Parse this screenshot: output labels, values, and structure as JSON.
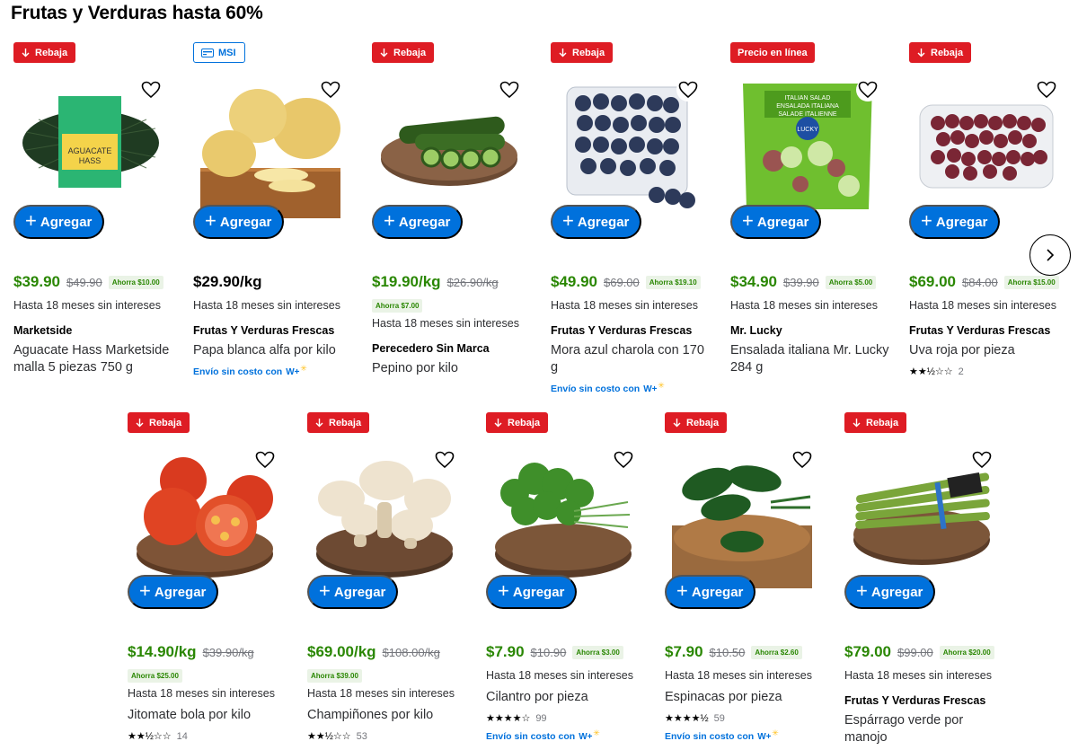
{
  "page": {
    "title": "Frutas y Verduras hasta 60%"
  },
  "controls": {
    "add_label": "Agregar",
    "next_icon": "chevron-right-icon"
  },
  "products": [
    {
      "badge": "Rebaja",
      "badge_type": "rebaja",
      "price": "$39.90",
      "old_price": "$49.90",
      "savings": "Ahorra $10.00",
      "savings_inline": true,
      "msi": "Hasta 18 meses sin intereses",
      "brand": "Marketside",
      "name": "Aguacate Hass Marketside malla 5 piezas 750 g",
      "image": "avocado-bag"
    },
    {
      "badge": "MSI",
      "badge_type": "msi",
      "price": "$29.90/kg",
      "price_black": true,
      "msi": "Hasta 18 meses sin intereses",
      "brand": "Frutas Y Verduras Frescas",
      "name": "Papa blanca alfa por kilo",
      "shipping": "Envío sin costo con",
      "shipping_logo": "W+",
      "image": "potatoes"
    },
    {
      "badge": "Rebaja",
      "badge_type": "rebaja",
      "price": "$19.90/kg",
      "old_price": "$26.90/kg",
      "savings": "Ahorra $7.00",
      "savings_inline": false,
      "msi": "Hasta 18 meses sin intereses",
      "brand": "Perecedero Sin Marca",
      "name": "Pepino por kilo",
      "image": "cucumber"
    },
    {
      "badge": "Rebaja",
      "badge_type": "rebaja",
      "price": "$49.90",
      "old_price": "$69.00",
      "savings": "Ahorra $19.10",
      "savings_inline": true,
      "msi": "Hasta 18 meses sin intereses",
      "brand": "Frutas Y Verduras Frescas",
      "name": "Mora azul charola con 170 g",
      "shipping": "Envío sin costo con",
      "shipping_logo": "W+",
      "image": "blueberries"
    },
    {
      "badge": "Precio en línea",
      "badge_type": "linea",
      "price": "$34.90",
      "old_price": "$39.90",
      "savings": "Ahorra $5.00",
      "savings_inline": true,
      "msi": "Hasta 18 meses sin intereses",
      "brand": "Mr. Lucky",
      "name": "Ensalada italiana Mr. Lucky 284 g",
      "image": "salad-bag"
    },
    {
      "badge": "Rebaja",
      "badge_type": "rebaja",
      "price": "$69.00",
      "old_price": "$84.00",
      "savings": "Ahorra $15.00",
      "savings_inline": true,
      "msi": "Hasta 18 meses sin intereses",
      "brand": "Frutas Y Verduras Frescas",
      "name": "Uva roja por pieza",
      "rating_stars": "★★½☆☆",
      "rating_count": "2",
      "image": "grapes"
    },
    {
      "badge": "Rebaja",
      "badge_type": "rebaja",
      "price": "$14.90/kg",
      "old_price": "$39.90/kg",
      "savings": "Ahorra $25.00",
      "savings_inline": false,
      "msi": "Hasta 18 meses sin intereses",
      "name": "Jitomate bola por kilo",
      "rating_stars": "★★½☆☆",
      "rating_count": "14",
      "image": "tomatoes"
    },
    {
      "badge": "Rebaja",
      "badge_type": "rebaja",
      "price": "$69.00/kg",
      "old_price": "$108.00/kg",
      "savings": "Ahorra $39.00",
      "savings_inline": false,
      "msi": "Hasta 18 meses sin intereses",
      "name": "Champiñones por kilo",
      "rating_stars": "★★½☆☆",
      "rating_count": "53",
      "image": "mushrooms"
    },
    {
      "badge": "Rebaja",
      "badge_type": "rebaja",
      "price": "$7.90",
      "old_price": "$10.90",
      "savings": "Ahorra $3.00",
      "savings_inline": true,
      "msi": "Hasta 18 meses sin intereses",
      "name": "Cilantro por pieza",
      "rating_stars": "★★★★☆",
      "rating_count": "99",
      "shipping": "Envío sin costo con",
      "shipping_logo": "W+",
      "image": "cilantro"
    },
    {
      "badge": "Rebaja",
      "badge_type": "rebaja",
      "price": "$7.90",
      "old_price": "$10.50",
      "savings": "Ahorra $2.60",
      "savings_inline": true,
      "msi": "Hasta 18 meses sin intereses",
      "name": "Espinacas por pieza",
      "rating_stars": "★★★★½",
      "rating_count": "59",
      "shipping": "Envío sin costo con",
      "shipping_logo": "W+",
      "image": "spinach"
    },
    {
      "badge": "Rebaja",
      "badge_type": "rebaja",
      "price": "$79.00",
      "old_price": "$99.00",
      "savings": "Ahorra $20.00",
      "savings_inline": true,
      "msi": "Hasta 18 meses sin intereses",
      "brand": "Frutas Y Verduras Frescas",
      "name": "Espárrago verde por manojo",
      "image": "asparagus"
    }
  ]
}
